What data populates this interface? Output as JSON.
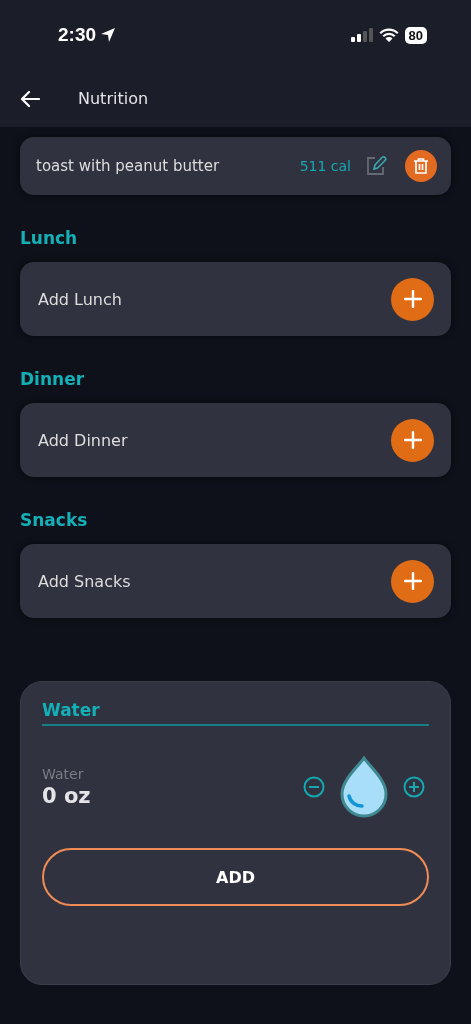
{
  "status_bar": {
    "time": "2:30",
    "battery": "80"
  },
  "header": {
    "title": "Nutrition"
  },
  "logged_items": [
    {
      "name": "toast with peanut butter",
      "calories": "511 cal"
    }
  ],
  "meals": [
    {
      "title": "Lunch",
      "add_label": "Add Lunch"
    },
    {
      "title": "Dinner",
      "add_label": "Add Dinner"
    },
    {
      "title": "Snacks",
      "add_label": "Add Snacks"
    }
  ],
  "water": {
    "title": "Water",
    "label": "Water",
    "amount": "0 oz",
    "button": "ADD"
  }
}
